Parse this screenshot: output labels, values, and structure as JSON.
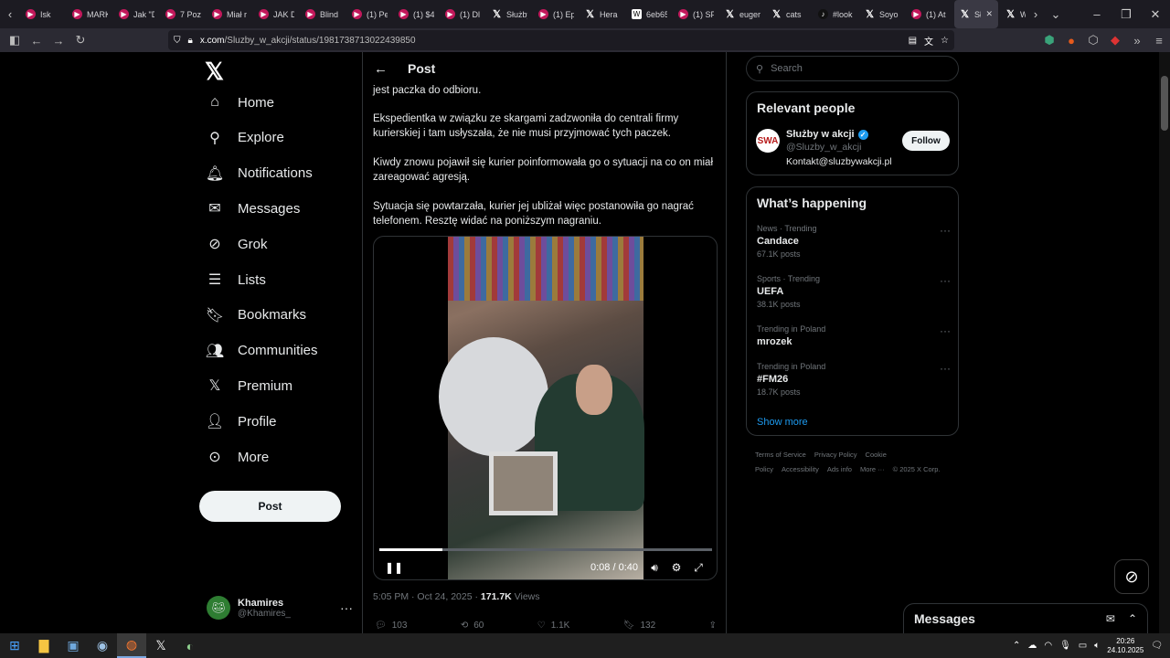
{
  "browser": {
    "tabs": [
      {
        "title": "Isk",
        "icon": "youtube-icon"
      },
      {
        "title": "MARK",
        "icon": "youtube-icon"
      },
      {
        "title": "Jak \"D",
        "icon": "youtube-icon"
      },
      {
        "title": "7 Poz",
        "icon": "youtube-icon"
      },
      {
        "title": "Miał r",
        "icon": "youtube-icon"
      },
      {
        "title": "JAK D",
        "icon": "youtube-icon"
      },
      {
        "title": "Blind",
        "icon": "youtube-icon"
      },
      {
        "title": "(1) Pe",
        "icon": "youtube-icon"
      },
      {
        "title": "(1) $4",
        "icon": "youtube-icon"
      },
      {
        "title": "(1) Dl",
        "icon": "youtube-icon"
      },
      {
        "title": "Służby",
        "icon": "x-icon"
      },
      {
        "title": "(1) Ep",
        "icon": "youtube-icon"
      },
      {
        "title": "Hera",
        "icon": "x-icon"
      },
      {
        "title": "6eb65",
        "icon": "wikipedia-icon"
      },
      {
        "title": "(1) SP",
        "icon": "youtube-icon"
      },
      {
        "title": "euger",
        "icon": "x-icon"
      },
      {
        "title": "cats",
        "icon": "x-icon"
      },
      {
        "title": "#look",
        "icon": "tiktok-icon"
      },
      {
        "title": "Soyo",
        "icon": "x-icon"
      },
      {
        "title": "(1) At",
        "icon": "youtube-icon"
      },
      {
        "title": "Słu",
        "icon": "x-icon",
        "active": true
      },
      {
        "title": "World",
        "icon": "x-icon"
      }
    ],
    "url_host": "x.com",
    "url_path": "/Sluzby_w_akcji/status/1981738713022439850"
  },
  "nav": {
    "items": [
      {
        "label": "Home",
        "icon": "home-icon"
      },
      {
        "label": "Explore",
        "icon": "search-icon"
      },
      {
        "label": "Notifications",
        "icon": "bell-icon"
      },
      {
        "label": "Messages",
        "icon": "mail-icon"
      },
      {
        "label": "Grok",
        "icon": "grok-icon"
      },
      {
        "label": "Lists",
        "icon": "list-icon"
      },
      {
        "label": "Bookmarks",
        "icon": "bookmark-icon"
      },
      {
        "label": "Communities",
        "icon": "people-icon"
      },
      {
        "label": "Premium",
        "icon": "x-icon"
      },
      {
        "label": "Profile",
        "icon": "person-icon"
      },
      {
        "label": "More",
        "icon": "more-circle-icon"
      }
    ],
    "post_button": "Post",
    "account": {
      "name": "Khamires",
      "handle": "@Khamires_"
    }
  },
  "main": {
    "header_title": "Post",
    "paragraphs": [
      "jest paczka do odbioru.",
      "Ekspedientka w związku ze skargami zadzwoniła do centrali firmy kurierskiej i tam usłyszała, że nie musi przyjmować tych paczek.",
      "Kiwdy znowu pojawił się kurier poinformowała go o sytuacji na co on miał zareagować agresją.",
      "Sytuacja się powtarzała, kurier jej ubliżał więc postanowiła go nagrać telefonem. Resztę widać na poniższym nagraniu."
    ],
    "video": {
      "time": "0:08 / 0:40",
      "progress": 0.19
    },
    "meta": {
      "time": "5:05 PM · Oct 24, 2025 · ",
      "views": "171.7K",
      "views_label": " Views"
    },
    "actions": {
      "replies": "103",
      "reposts": "60",
      "likes": "1.1K",
      "bookmarks": "132"
    }
  },
  "right": {
    "search_placeholder": "Search",
    "relevant": {
      "title": "Relevant people",
      "name": "Służby w akcji",
      "handle": "@Sluzby_w_akcji",
      "bio": "Kontakt@sluzbywakcji.pl",
      "follow": "Follow"
    },
    "happening": {
      "title": "What’s happening",
      "trends": [
        {
          "meta": "News · Trending",
          "name": "Candace",
          "count": "67.1K posts"
        },
        {
          "meta": "Sports · Trending",
          "name": "UEFA",
          "count": "38.1K posts"
        },
        {
          "meta": "Trending in Poland",
          "name": "mrozek",
          "count": ""
        },
        {
          "meta": "Trending in Poland",
          "name": "#FM26",
          "count": "18.7K posts"
        }
      ],
      "show_more": "Show more"
    },
    "footer": [
      "Terms of Service",
      "Privacy Policy",
      "Cookie Policy",
      "Accessibility",
      "Ads info",
      "More ···",
      "© 2025 X Corp."
    ],
    "messages_dock": "Messages"
  },
  "taskbar": {
    "time": "20:26",
    "date": "24.10.2025"
  },
  "colors": {
    "accent": "#1d9bf0",
    "background": "#000000",
    "border": "#2f3336",
    "muted": "#71767b"
  }
}
